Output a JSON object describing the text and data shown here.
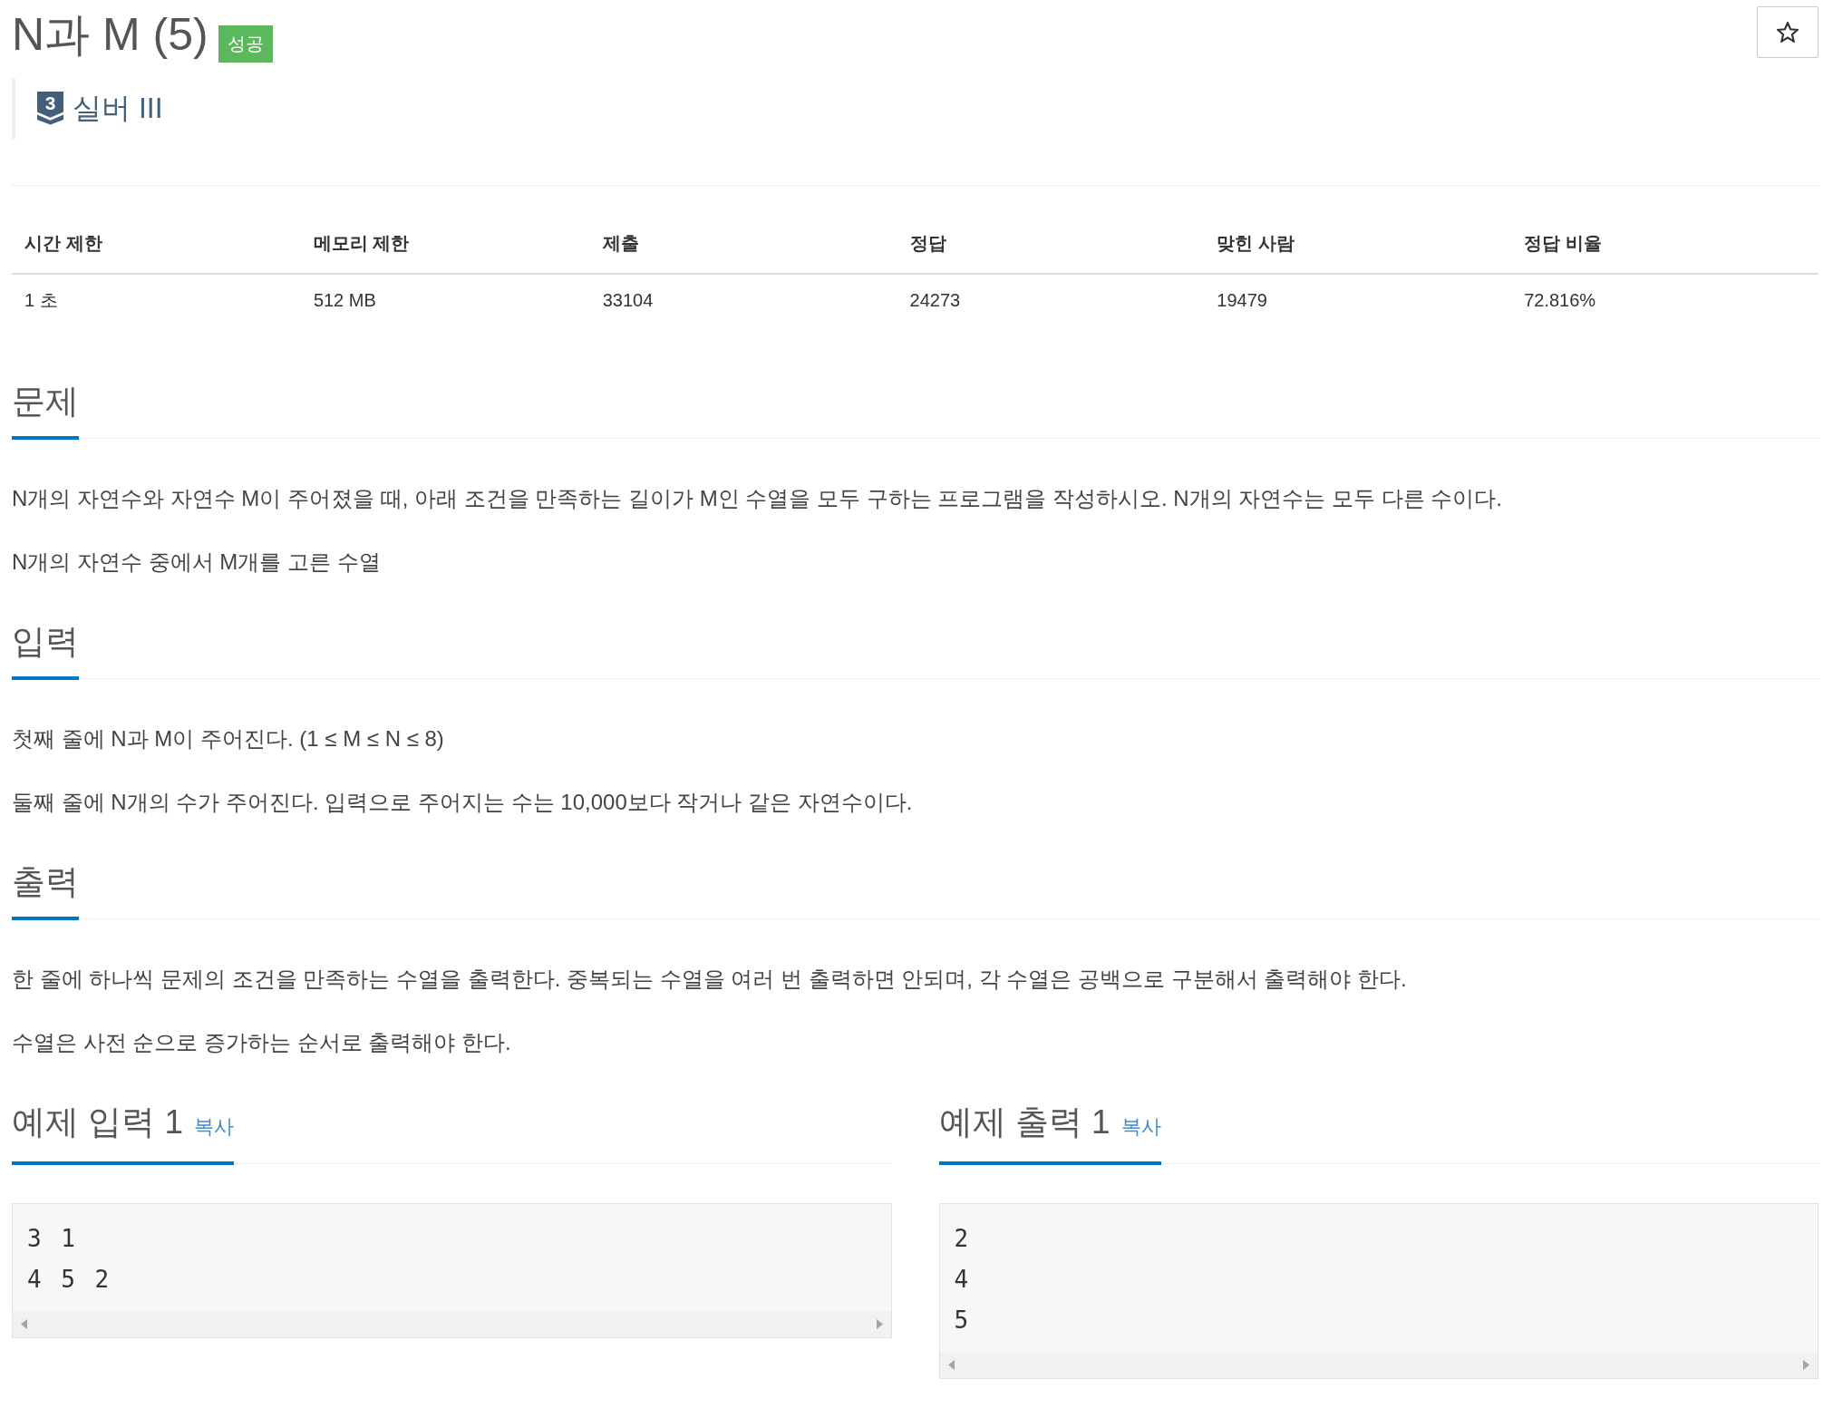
{
  "problem": {
    "title": "N과 M (5)",
    "result_badge": "성공",
    "starred": false
  },
  "tier": {
    "number": "3",
    "name": "실버 III"
  },
  "info_table": {
    "columns": [
      "시간 제한",
      "메모리 제한",
      "제출",
      "정답",
      "맞힌 사람",
      "정답 비율"
    ],
    "rows": [
      [
        "1 초",
        "512 MB",
        "33104",
        "24273",
        "19479",
        "72.816%"
      ]
    ]
  },
  "sections": [
    {
      "heading": "문제",
      "paragraphs": [
        "N개의 자연수와 자연수 M이 주어졌을 때, 아래 조건을 만족하는 길이가 M인 수열을 모두 구하는 프로그램을 작성하시오. N개의 자연수는 모두 다른 수이다.",
        "N개의 자연수 중에서 M개를 고른 수열"
      ]
    },
    {
      "heading": "입력",
      "paragraphs": [
        "첫째 줄에 N과 M이 주어진다. (1 ≤ M ≤ N ≤ 8)",
        "둘째 줄에 N개의 수가 주어진다. 입력으로 주어지는 수는 10,000보다 작거나 같은 자연수이다."
      ]
    },
    {
      "heading": "출력",
      "paragraphs": [
        "한 줄에 하나씩 문제의 조건을 만족하는 수열을 출력한다. 중복되는 수열을 여러 번 출력하면 안되며, 각 수열은 공백으로 구분해서 출력해야 한다.",
        "수열은 사전 순으로 증가하는 순서로 출력해야 한다."
      ]
    }
  ],
  "samples": [
    {
      "heading": "예제 입력 1",
      "copy_link": "복사",
      "lines": [
        "3 1",
        "4 5 2"
      ]
    },
    {
      "heading": "예제 출력 1",
      "copy_link": "복사",
      "lines": [
        "2",
        "4",
        "5"
      ]
    }
  ]
}
